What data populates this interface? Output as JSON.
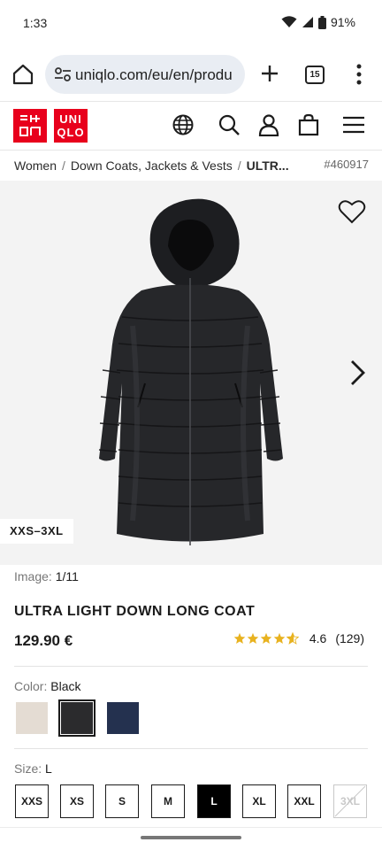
{
  "status_bar": {
    "time": "1:33",
    "battery": "91%"
  },
  "browser": {
    "url": "uniqlo.com/eu/en/produ",
    "tab_count": "15"
  },
  "brand": {
    "logo_top": [
      "UNI",
      "QLO"
    ],
    "logo_bottom": [
      "UNI",
      "QLO"
    ],
    "accent": "#e8001c"
  },
  "breadcrumb": {
    "items": [
      "Women",
      "Down Coats, Jackets & Vests",
      "ULTR..."
    ],
    "product_id": "#460917"
  },
  "gallery": {
    "size_range": "XXS–3XL",
    "counter_label": "Image:",
    "counter_value": "1/11"
  },
  "product": {
    "name": "ULTRA LIGHT DOWN LONG COAT",
    "price": "129.90 €",
    "rating": {
      "stars": 4.6,
      "value": "4.6",
      "count": "(129)",
      "star_color": "#e8b21f"
    }
  },
  "color": {
    "label": "Color:",
    "selected": "Black",
    "options": [
      {
        "name": "Beige",
        "hex": "#e4dcd3"
      },
      {
        "name": "Black",
        "hex": "#2b2b2d"
      },
      {
        "name": "Navy",
        "hex": "#24314f"
      }
    ]
  },
  "size": {
    "label": "Size:",
    "selected": "L",
    "options": [
      {
        "label": "XXS",
        "state": "available"
      },
      {
        "label": "XS",
        "state": "available"
      },
      {
        "label": "S",
        "state": "available"
      },
      {
        "label": "M",
        "state": "available"
      },
      {
        "label": "L",
        "state": "selected"
      },
      {
        "label": "XL",
        "state": "available"
      },
      {
        "label": "XXL",
        "state": "available"
      },
      {
        "label": "3XL",
        "state": "unavailable"
      }
    ]
  }
}
